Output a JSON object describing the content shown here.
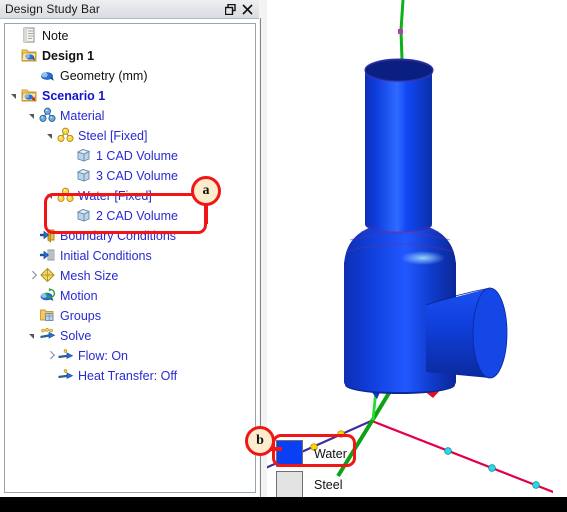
{
  "panel": {
    "title": "Design Study Bar",
    "restore_icon": "restore-window-icon",
    "close_icon": "close-icon",
    "tree": [
      {
        "label": "Note",
        "indent": 0,
        "icon": "note-icon",
        "expander": "none",
        "style": "black"
      },
      {
        "label": "Design 1",
        "indent": 0,
        "icon": "design-icon",
        "expander": "none",
        "style": "black-bold"
      },
      {
        "label": "Geometry (mm)",
        "indent": 1,
        "icon": "geometry-icon",
        "expander": "none",
        "style": "black"
      },
      {
        "label": "Scenario 1",
        "indent": 0,
        "icon": "scenario-icon",
        "expander": "open",
        "style": "blue-bold"
      },
      {
        "label": "Material",
        "indent": 1,
        "icon": "material-icon",
        "expander": "open",
        "style": "blue"
      },
      {
        "label": "Steel [Fixed]",
        "indent": 2,
        "icon": "material-yellow-icon",
        "expander": "open",
        "style": "blue"
      },
      {
        "label": "1 CAD Volume",
        "indent": 3,
        "icon": "cad-volume-icon",
        "expander": "none",
        "style": "blue"
      },
      {
        "label": "3 CAD Volume",
        "indent": 3,
        "icon": "cad-volume-icon",
        "expander": "none",
        "style": "blue"
      },
      {
        "label": "Water [Fixed]",
        "indent": 2,
        "icon": "material-yellow-icon",
        "expander": "open",
        "style": "blue"
      },
      {
        "label": "2 CAD Volume",
        "indent": 3,
        "icon": "cad-volume-icon",
        "expander": "none",
        "style": "blue"
      },
      {
        "label": "Boundary Conditions",
        "indent": 1,
        "icon": "boundary-conditions-icon",
        "expander": "none",
        "style": "blue"
      },
      {
        "label": "Initial Conditions",
        "indent": 1,
        "icon": "initial-conditions-icon",
        "expander": "none",
        "style": "blue"
      },
      {
        "label": "Mesh Size",
        "indent": 1,
        "icon": "mesh-size-icon",
        "expander": "closed",
        "style": "blue"
      },
      {
        "label": "Motion",
        "indent": 1,
        "icon": "motion-icon",
        "expander": "none",
        "style": "blue"
      },
      {
        "label": "Groups",
        "indent": 1,
        "icon": "groups-icon",
        "expander": "none",
        "style": "blue"
      },
      {
        "label": "Solve",
        "indent": 1,
        "icon": "solve-icon",
        "expander": "open",
        "style": "blue"
      },
      {
        "label": "Flow: On",
        "indent": 2,
        "icon": "flow-icon",
        "expander": "closed",
        "style": "blue"
      },
      {
        "label": "Heat Transfer: Off",
        "indent": 2,
        "icon": "flow-icon",
        "expander": "none",
        "style": "blue"
      }
    ]
  },
  "callouts": [
    {
      "id": "a",
      "label": "a"
    },
    {
      "id": "b",
      "label": "b"
    }
  ],
  "legend": {
    "items": [
      {
        "label": "Water",
        "color": "#0b3ff4"
      },
      {
        "label": "Steel",
        "color": "#e3e3e3"
      }
    ]
  },
  "colors": {
    "tree_link": "#2a2ad0",
    "callout_red": "#f01616",
    "callout_fill": "#fdeccd",
    "model_blue": "#0a3ae8",
    "axis_green": "#00a80c",
    "axis_red": "#e00040",
    "axis_purple": "#3b2f9e"
  }
}
